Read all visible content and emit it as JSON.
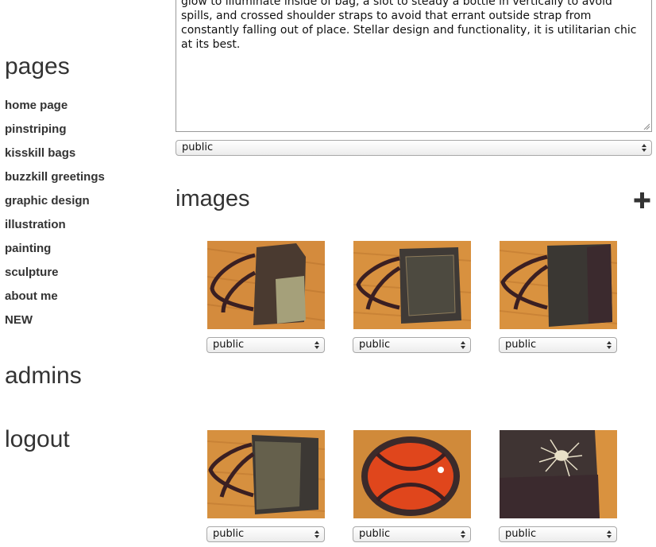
{
  "sidebar": {
    "pages_heading": "pages",
    "items": [
      {
        "label": "home page"
      },
      {
        "label": "pinstriping"
      },
      {
        "label": "kisskill bags"
      },
      {
        "label": "buzzkill greetings"
      },
      {
        "label": "graphic design"
      },
      {
        "label": "illustration"
      },
      {
        "label": "painting"
      },
      {
        "label": "sculpture"
      },
      {
        "label": "about me"
      },
      {
        "label": "NEW"
      }
    ],
    "admins_heading": "admins",
    "logout_heading": "logout"
  },
  "main": {
    "description_text": "glow to illuminate inside of bag, a slot to steady a bottle in vertically to avoid spills, and crossed shoulder straps to avoid that errant outside strap from constantly falling out of place. Stellar design and functionality, it is utilitarian chic at its best.",
    "visibility_select": "public",
    "images_heading": "images",
    "add_icon": "plus-icon",
    "images": [
      {
        "visibility": "public",
        "subject": "bag-photo"
      },
      {
        "visibility": "public",
        "subject": "bag-photo"
      },
      {
        "visibility": "public",
        "subject": "bag-photo"
      },
      {
        "visibility": "public",
        "subject": "bag-photo"
      },
      {
        "visibility": "public",
        "subject": "bag-photo"
      },
      {
        "visibility": "public",
        "subject": "bag-photo"
      }
    ]
  },
  "colors": {
    "text": "#333333",
    "wood_floor": "#d9903e",
    "bag_dark": "#3b2a2a",
    "bag_lining": "#e0461c"
  }
}
